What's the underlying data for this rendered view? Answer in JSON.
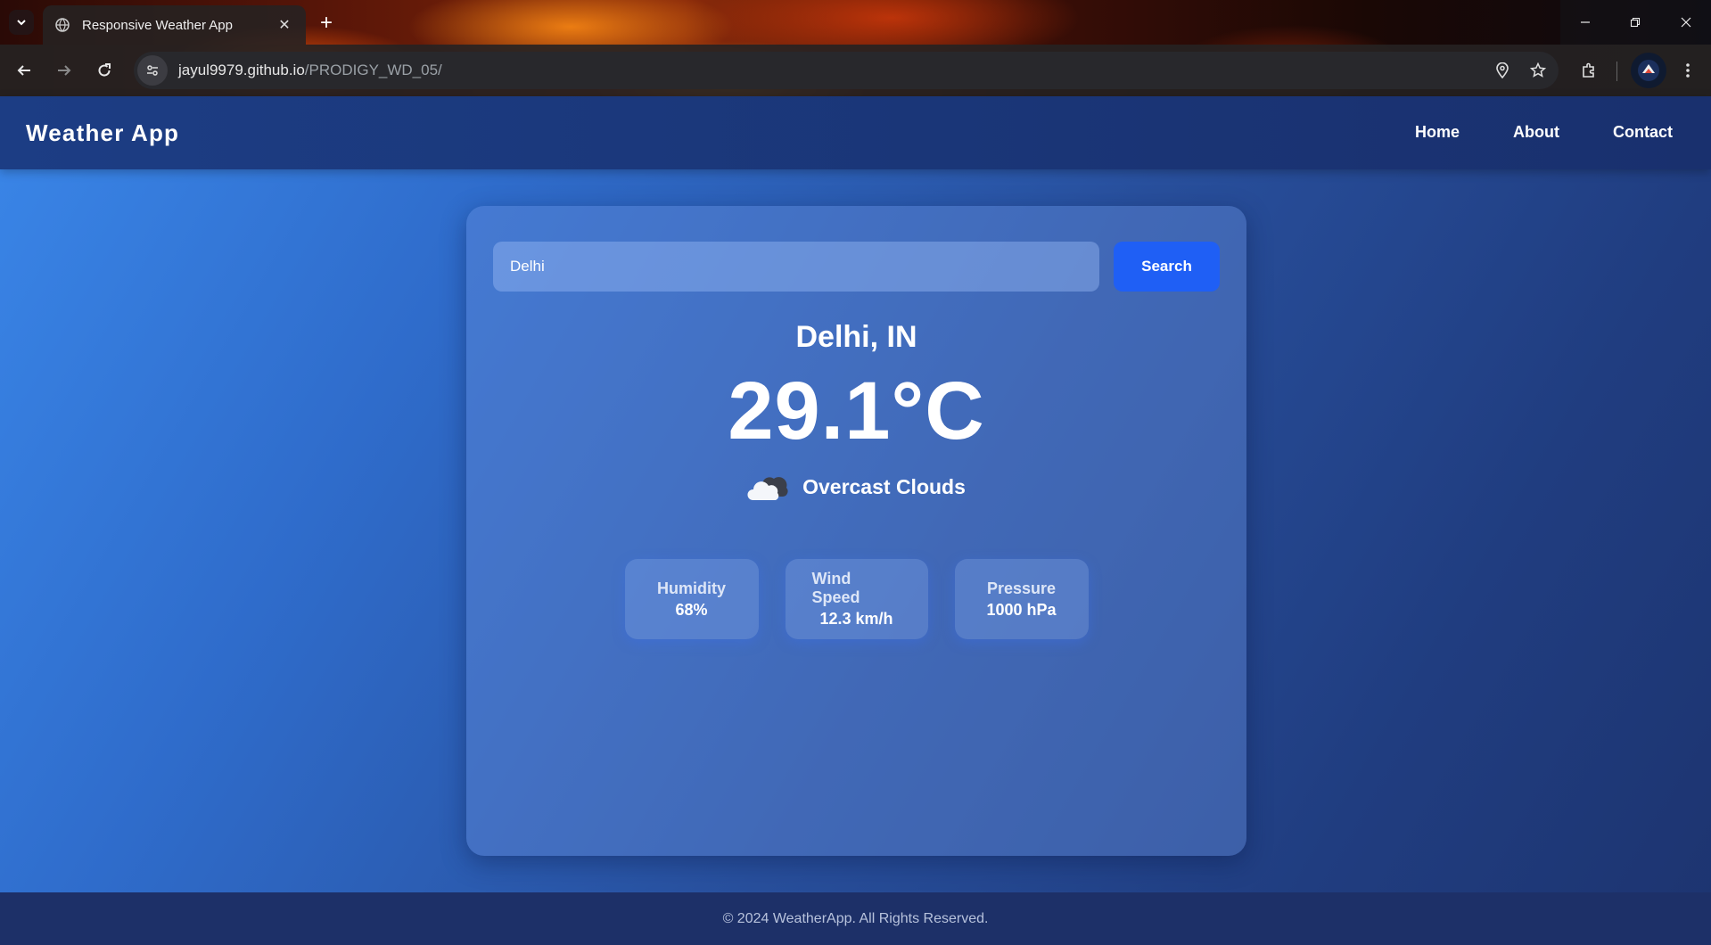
{
  "browser": {
    "tab_title": "Responsive Weather App",
    "url_host": "jayul9979.github.io",
    "url_path": "/PRODIGY_WD_05/"
  },
  "header": {
    "logo": "Weather App",
    "nav": [
      "Home",
      "About",
      "Contact"
    ]
  },
  "search": {
    "value": "Delhi",
    "button_label": "Search"
  },
  "weather": {
    "city": "Delhi, IN",
    "temperature": "29.1°C",
    "icon": "cloud-icon",
    "description": "Overcast Clouds"
  },
  "stats": [
    {
      "label": "Humidity",
      "value": "68%"
    },
    {
      "label": "Wind Speed",
      "value": "12.3 km/h"
    },
    {
      "label": "Pressure",
      "value": "1000 hPa"
    }
  ],
  "footer": {
    "text": "© 2024 WeatherApp. All Rights Reserved."
  },
  "colors": {
    "accent": "#1f5ff5",
    "header_bg": "#1c3d84",
    "footer_bg": "#1d3068"
  }
}
